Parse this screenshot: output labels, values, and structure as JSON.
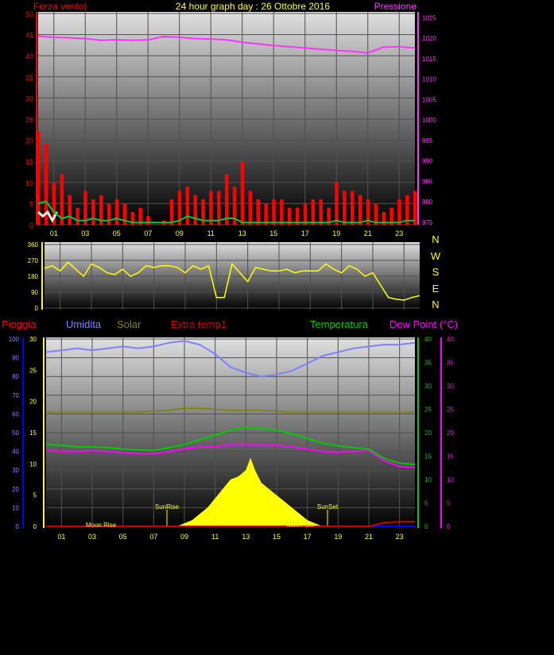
{
  "header": {
    "title": "24 hour graph day : 26 Ottobre 2016",
    "left_label": "Forza vento)",
    "right_label": "Pressione"
  },
  "colors": {
    "wind": "#ff0000",
    "avg_wind": "#00cc33",
    "gust_white": "#e8e8e8",
    "pressure": "#ff33ff",
    "direction": "#ffff00",
    "rain": "#0000ff",
    "humidity": "#8080ff",
    "solar": "#808000",
    "extra_temp": "#cc0000",
    "temperature": "#00cc00",
    "dewpoint": "#ff00ff",
    "solar_fill": "#ffff00",
    "axis_text": "#ffff00"
  },
  "chart_data": [
    {
      "type": "line",
      "name": "wind-pressure",
      "title": "24 hour graph day : 26 Ottobre 2016",
      "ylabel_left": "Forza vento)",
      "ylabel_right": "Pressione",
      "x_ticks": [
        "01",
        "03",
        "05",
        "07",
        "09",
        "11",
        "13",
        "15",
        "17",
        "19",
        "21",
        "23"
      ],
      "y_left_ticks": [
        0,
        5,
        10,
        15,
        20,
        25,
        30,
        35,
        40,
        45,
        50
      ],
      "y_right_ticks": [
        975,
        980,
        985,
        990,
        995,
        1000,
        1005,
        1010,
        1015,
        1020,
        1025
      ],
      "ylim_left": [
        0,
        50
      ],
      "ylim_right": [
        975,
        1027
      ],
      "xlim": [
        0,
        24
      ],
      "series": [
        {
          "key": "pressure",
          "axis": "right",
          "x": [
            0,
            1,
            2,
            3,
            4,
            5,
            6,
            7,
            8,
            9,
            10,
            11,
            12,
            13,
            14,
            15,
            16,
            17,
            18,
            19,
            20,
            21,
            22,
            23,
            24
          ],
          "y": [
            1020.5,
            1020.2,
            1020.1,
            1019.9,
            1019.5,
            1019.6,
            1019.5,
            1019.6,
            1020.4,
            1020.2,
            1019.9,
            1019.8,
            1019.6,
            1019.0,
            1018.6,
            1018.2,
            1017.9,
            1017.6,
            1017.3,
            1017.0,
            1016.8,
            1016.4,
            1017.8,
            1017.9,
            1017.6
          ]
        },
        {
          "key": "avg_wind",
          "axis": "left",
          "x": [
            0,
            0.5,
            1,
            1.5,
            2,
            2.5,
            3,
            3.5,
            4,
            4.5,
            5,
            5.5,
            6,
            6.5,
            7,
            7.5,
            8,
            8.5,
            9,
            9.5,
            10,
            10.5,
            11,
            11.5,
            12,
            12.5,
            13,
            13.5,
            14,
            14.5,
            15,
            15.5,
            16,
            16.5,
            17,
            17.5,
            18,
            18.5,
            19,
            19.5,
            20,
            20.5,
            21,
            21.5,
            22,
            22.5,
            23,
            23.5,
            24
          ],
          "y": [
            5,
            5.5,
            3,
            1.5,
            2,
            1,
            1,
            1.5,
            1,
            1,
            1.5,
            1,
            0.5,
            0.5,
            0.5,
            0.5,
            0.5,
            0.5,
            1,
            2,
            1.5,
            1,
            1,
            1,
            1.5,
            1.5,
            0.5,
            0.5,
            0.5,
            0.5,
            0.5,
            0.5,
            0.5,
            0.5,
            0.5,
            0.5,
            0.5,
            0.5,
            1,
            0.5,
            0.5,
            0.5,
            1,
            0.5,
            0.5,
            0.5,
            0.5,
            1,
            1
          ]
        },
        {
          "key": "wind",
          "axis": "left",
          "x": [
            0,
            0.5,
            1,
            1.5,
            2,
            2.5,
            3,
            3.5,
            4,
            4.5,
            5,
            5.5,
            6,
            6.5,
            7,
            7.5,
            8,
            8.5,
            9,
            9.5,
            10,
            10.5,
            11,
            11.5,
            12,
            12.5,
            13,
            13.5,
            14,
            14.5,
            15,
            15.5,
            16,
            16.5,
            17,
            17.5,
            18,
            18.5,
            19,
            19.5,
            20,
            20.5,
            21,
            21.5,
            22,
            22.5,
            23,
            23.5,
            24
          ],
          "y": [
            22,
            19,
            10,
            12,
            7,
            4,
            8,
            6,
            7,
            5,
            6,
            5,
            3,
            4,
            2,
            0,
            1,
            6,
            8,
            9,
            7,
            6,
            8,
            8,
            12,
            9,
            15,
            8,
            6,
            5,
            6,
            6,
            4,
            4,
            5,
            6,
            6,
            4,
            10,
            8,
            8,
            7,
            6,
            5,
            3,
            4,
            6,
            7,
            8
          ]
        },
        {
          "key": "gust_white",
          "axis": "left",
          "x": [
            0,
            0.3,
            0.6,
            0.9,
            1.2
          ],
          "y": [
            3,
            2,
            3,
            1,
            3
          ]
        }
      ]
    },
    {
      "type": "line",
      "name": "wind-direction",
      "y_ticks": [
        0,
        90,
        180,
        270,
        360
      ],
      "ylim": [
        0,
        360
      ],
      "xlim": [
        0,
        24
      ],
      "compass_labels": [
        "N",
        "W",
        "S",
        "E",
        "N"
      ],
      "series": [
        {
          "key": "direction",
          "x": [
            0,
            0.5,
            1,
            1.5,
            2,
            2.5,
            3,
            3.5,
            4,
            4.5,
            5,
            5.5,
            6,
            6.5,
            7,
            7.5,
            8,
            8.5,
            9,
            9.5,
            10,
            10.5,
            11,
            11.5,
            12,
            12.5,
            13,
            13.5,
            14,
            14.5,
            15,
            15.5,
            16,
            16.5,
            17,
            17.5,
            18,
            18.5,
            19,
            19.5,
            20,
            20.5,
            21,
            21.5,
            22,
            22.5,
            23,
            23.5,
            24
          ],
          "y": [
            225,
            240,
            210,
            260,
            220,
            180,
            250,
            230,
            200,
            190,
            220,
            180,
            200,
            240,
            230,
            240,
            240,
            230,
            200,
            240,
            220,
            240,
            60,
            60,
            250,
            200,
            150,
            230,
            220,
            210,
            210,
            220,
            200,
            210,
            210,
            210,
            250,
            220,
            200,
            240,
            220,
            180,
            200,
            130,
            60,
            50,
            45,
            60,
            70
          ]
        }
      ]
    },
    {
      "type": "line",
      "name": "temperature-humidity",
      "legend": [
        "Pioggia",
        "Umidita",
        "Solar",
        "Extra temp1",
        "Temperatura",
        "Dew Point (°C)"
      ],
      "x_ticks": [
        "01",
        "03",
        "05",
        "07",
        "09",
        "11",
        "13",
        "15",
        "17",
        "19",
        "21",
        "23"
      ],
      "humidity_ticks": [
        0,
        10,
        20,
        30,
        40,
        50,
        60,
        70,
        80,
        90,
        100
      ],
      "rain_ticks": [
        0,
        5,
        10,
        15,
        20,
        25,
        30
      ],
      "temp_ticks": [
        0,
        5,
        10,
        15,
        20,
        25,
        30,
        35,
        40
      ],
      "ylim_humidity": [
        0,
        100
      ],
      "ylim_rain": [
        0,
        30
      ],
      "ylim_temp": [
        0,
        40
      ],
      "xlim": [
        0,
        24
      ],
      "annotations": [
        "SunRise",
        "SunSet",
        "Moon Rise",
        "Moon Set"
      ],
      "series": [
        {
          "key": "humidity",
          "axis": "humidity",
          "x": [
            0,
            1,
            2,
            3,
            4,
            5,
            6,
            7,
            8,
            9,
            10,
            11,
            12,
            13,
            14,
            15,
            16,
            17,
            18,
            19,
            20,
            21,
            22,
            23,
            24
          ],
          "y": [
            93,
            94,
            95,
            94,
            95,
            96,
            95,
            96,
            98,
            99,
            97,
            92,
            85,
            82,
            80,
            81,
            83,
            87,
            91,
            93,
            95,
            96,
            97,
            97,
            98
          ]
        },
        {
          "key": "solar",
          "axis": "humidity",
          "x": [
            0,
            2,
            4,
            6,
            8,
            9,
            10,
            12,
            14,
            16,
            18,
            20,
            22,
            24
          ],
          "y": [
            61,
            61,
            61,
            61,
            62,
            63,
            63,
            62,
            62,
            61,
            61,
            61,
            61,
            61
          ]
        },
        {
          "key": "temperature",
          "axis": "temp",
          "x": [
            0,
            1,
            2,
            3,
            4,
            5,
            6,
            7,
            8,
            9,
            10,
            11,
            12,
            13,
            14,
            15,
            16,
            17,
            18,
            19,
            20,
            21,
            22,
            23,
            24
          ],
          "y": [
            17.5,
            17.3,
            17.0,
            17.0,
            16.8,
            16.5,
            16.3,
            16.2,
            16.8,
            17.5,
            18.5,
            19.5,
            20.5,
            21.2,
            21.0,
            20.5,
            19.8,
            18.8,
            17.8,
            17.2,
            16.8,
            16.5,
            14.5,
            13.5,
            13.2
          ]
        },
        {
          "key": "dewpoint",
          "axis": "temp",
          "x": [
            0,
            1,
            2,
            3,
            4,
            5,
            6,
            7,
            8,
            9,
            10,
            11,
            12,
            13,
            14,
            15,
            16,
            17,
            18,
            19,
            20,
            21,
            22,
            23,
            24
          ],
          "y": [
            16.3,
            16.0,
            16.0,
            16.2,
            16.0,
            15.8,
            15.5,
            15.5,
            16.0,
            16.5,
            17.0,
            17.0,
            17.5,
            17.5,
            17.3,
            17.3,
            17.0,
            16.5,
            16.0,
            15.8,
            16.0,
            16.2,
            14.0,
            12.8,
            12.6
          ]
        },
        {
          "key": "extra_temp",
          "axis": "temp",
          "x": [
            0,
            1,
            2,
            3,
            4,
            5,
            6,
            7,
            8,
            9,
            10,
            11,
            12,
            13,
            14,
            15,
            16,
            17,
            18,
            19,
            20,
            21,
            22,
            23,
            24
          ],
          "y": [
            0,
            0,
            0,
            0,
            0,
            0,
            0,
            0,
            0,
            0,
            0,
            0,
            0,
            0,
            0,
            0,
            0,
            0,
            0,
            0,
            0,
            0,
            0.8,
            1.0,
            1.0
          ]
        },
        {
          "key": "rain",
          "axis": "rain",
          "x": [
            0,
            24
          ],
          "y": [
            0,
            0
          ]
        },
        {
          "key": "solar_fill",
          "axis": "rain",
          "x": [
            8.5,
            9,
            9.5,
            10,
            10.5,
            11,
            11.5,
            12,
            12.5,
            13,
            13.3,
            13.6,
            14,
            14.5,
            15,
            15.5,
            16,
            16.5,
            17,
            17.5,
            18
          ],
          "y": [
            0,
            0.5,
            1,
            2,
            3,
            4.5,
            6,
            7.5,
            8,
            9,
            11,
            9,
            7,
            6,
            5,
            4,
            3,
            2,
            1,
            0.5,
            0
          ]
        }
      ]
    }
  ]
}
